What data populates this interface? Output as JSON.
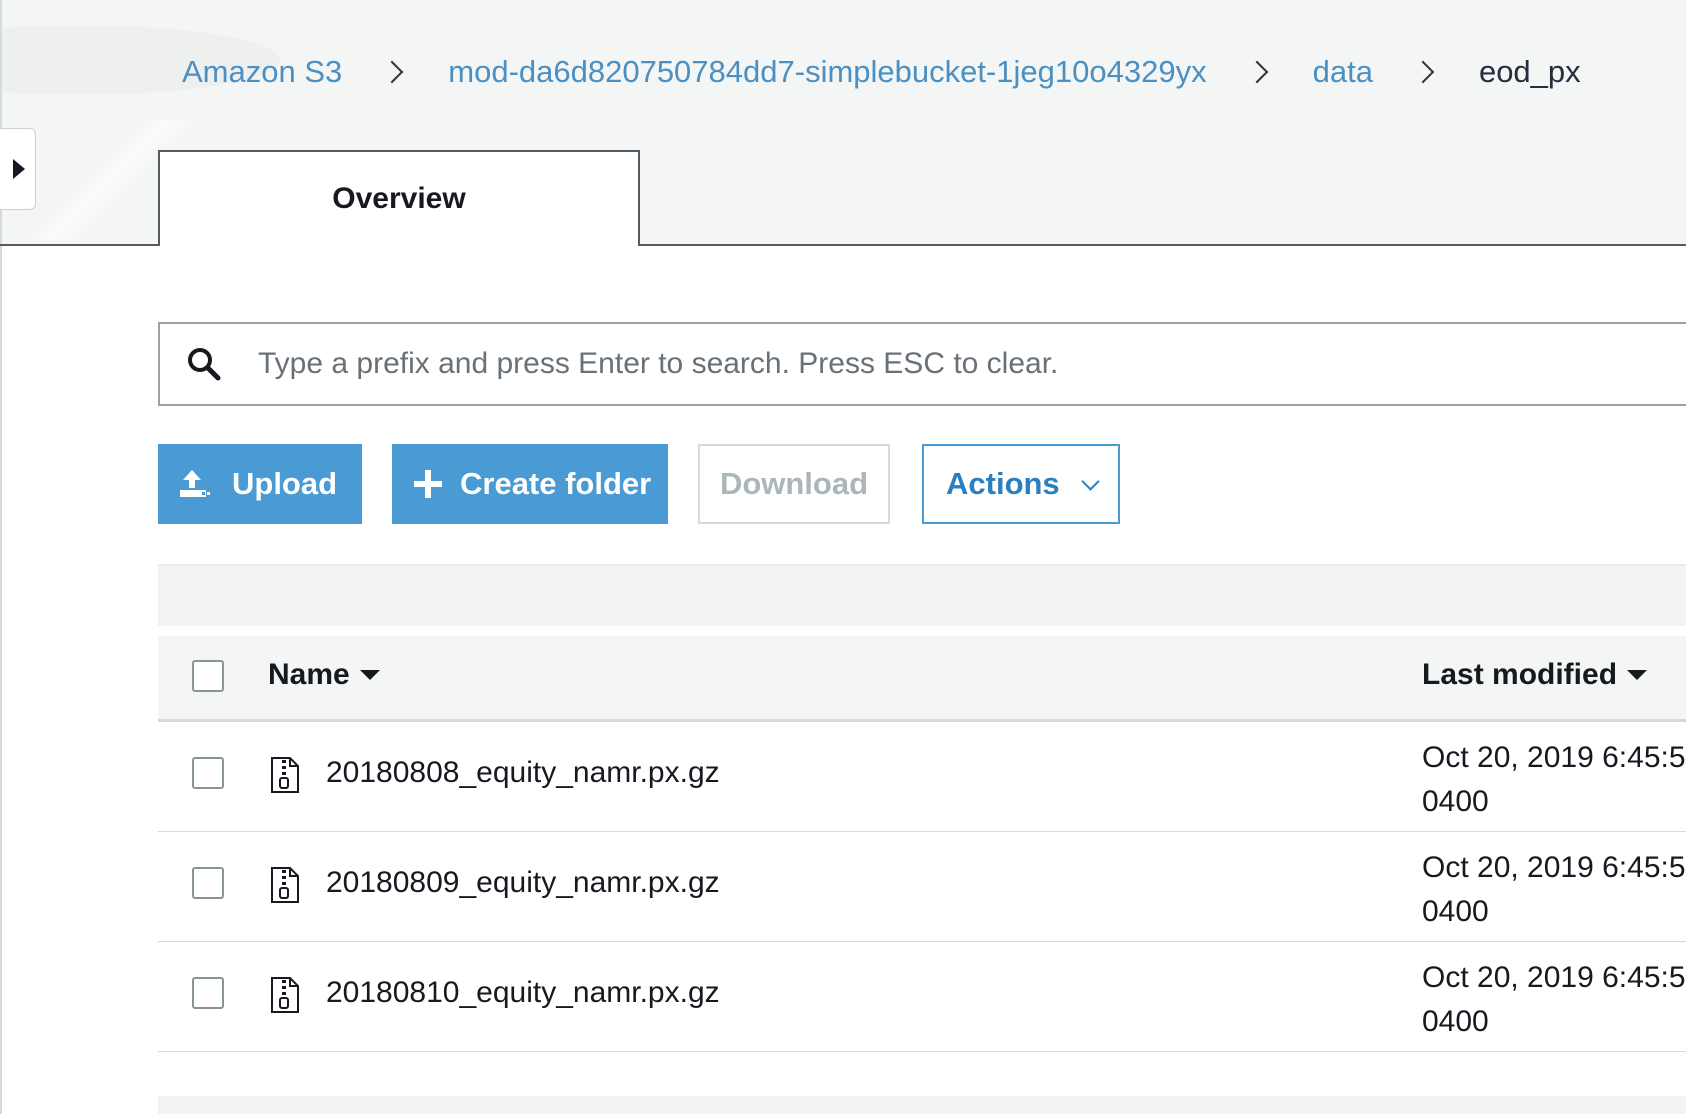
{
  "breadcrumb": {
    "root": "Amazon S3",
    "bucket": "mod-da6d820750784dd7-simplebucket-1jeg10o4329yx",
    "folder": "data",
    "current": "eod_px"
  },
  "tabs": {
    "overview": "Overview"
  },
  "search": {
    "placeholder": "Type a prefix and press Enter to search. Press ESC to clear."
  },
  "toolbar": {
    "upload": "Upload",
    "create_folder": "Create folder",
    "download": "Download",
    "actions": "Actions"
  },
  "table": {
    "columns": {
      "name": "Name",
      "last_modified": "Last modified"
    },
    "rows": [
      {
        "name": "20180808_equity_namr.px.gz",
        "modified_line1": "Oct 20, 2019 6:45:5",
        "modified_line2": "0400"
      },
      {
        "name": "20180809_equity_namr.px.gz",
        "modified_line1": "Oct 20, 2019 6:45:5",
        "modified_line2": "0400"
      },
      {
        "name": "20180810_equity_namr.px.gz",
        "modified_line1": "Oct 20, 2019 6:45:5",
        "modified_line2": "0400"
      }
    ]
  },
  "colors": {
    "primary_button": "#4a9ad4",
    "link": "#4a90c2",
    "text": "#16191f"
  },
  "icons": {
    "upload": "upload-icon",
    "create_folder": "plus-icon",
    "actions": "chevron-down-icon",
    "search": "search-icon",
    "file": "zip-file-icon",
    "sidebar_toggle": "caret-right-icon"
  }
}
